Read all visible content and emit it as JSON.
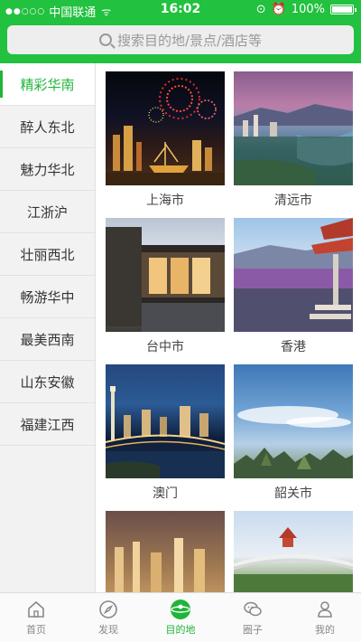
{
  "status_bar": {
    "signal": "●●○○○",
    "carrier": "中国联通",
    "wifi": "ᯤ",
    "time": "16:02",
    "battery": "100%"
  },
  "search": {
    "placeholder": "搜索目的地/景点/酒店等"
  },
  "sidebar": {
    "items": [
      {
        "label": "精彩华南",
        "active": true
      },
      {
        "label": "醉人东北"
      },
      {
        "label": "魅力华北"
      },
      {
        "label": "江浙沪"
      },
      {
        "label": "壮丽西北"
      },
      {
        "label": "畅游华中"
      },
      {
        "label": "最美西南"
      },
      {
        "label": "山东安徽"
      },
      {
        "label": "福建江西"
      }
    ]
  },
  "destinations": [
    {
      "name": "上海市"
    },
    {
      "name": "清远市"
    },
    {
      "name": "台中市"
    },
    {
      "name": "香港"
    },
    {
      "name": "澳门"
    },
    {
      "name": "韶关市"
    }
  ],
  "tabs": [
    {
      "label": "首页",
      "icon": "home-icon"
    },
    {
      "label": "发现",
      "icon": "compass-icon"
    },
    {
      "label": "目的地",
      "icon": "destination-icon",
      "active": true
    },
    {
      "label": "圈子",
      "icon": "chat-icon"
    },
    {
      "label": "我的",
      "icon": "profile-icon"
    }
  ],
  "colors": {
    "brand_green": "#22c13f",
    "active_text": "#1fb53a"
  }
}
